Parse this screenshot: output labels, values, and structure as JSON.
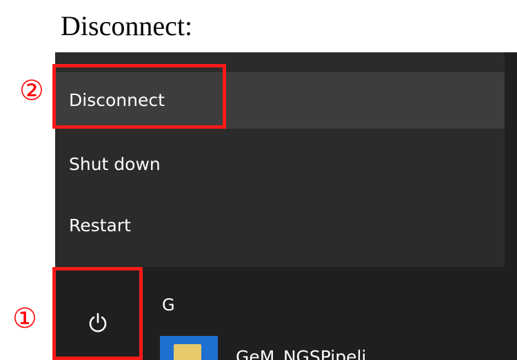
{
  "heading": "Disconnect:",
  "power_menu": {
    "items": [
      {
        "label": "Disconnect",
        "highlighted": true
      },
      {
        "label": "Shut down",
        "highlighted": false
      },
      {
        "label": "Restart",
        "highlighted": false
      }
    ]
  },
  "start_menu": {
    "power_icon": "power-icon",
    "letter_header": "G",
    "app": {
      "label": "GeM_NGSPipeli",
      "icon": "folder-icon"
    }
  },
  "annotations": {
    "step1_marker": "①",
    "step2_marker": "②",
    "color": "#ff0000"
  }
}
